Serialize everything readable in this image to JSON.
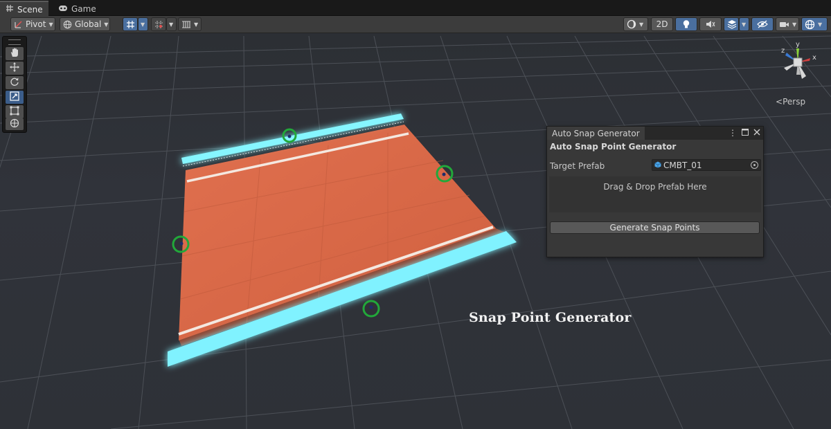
{
  "tabs": [
    {
      "label": "Scene",
      "icon": "grid-icon",
      "active": true
    },
    {
      "label": "Game",
      "icon": "gamepad-icon",
      "active": false
    }
  ],
  "toolbar": {
    "pivot_label": "Pivot",
    "global_label": "Global",
    "mode_2d_label": "2D"
  },
  "tools": [
    {
      "name": "hand-tool",
      "icon": "hand-icon"
    },
    {
      "name": "move-tool",
      "icon": "move-icon"
    },
    {
      "name": "rotate-tool",
      "icon": "rotate-icon"
    },
    {
      "name": "scale-tool",
      "icon": "scale-icon",
      "selected": true
    },
    {
      "name": "rect-tool",
      "icon": "rect-icon"
    },
    {
      "name": "transform-tool",
      "icon": "transform-icon"
    }
  ],
  "gizmo": {
    "axis_y": "y",
    "axis_z": "z",
    "axis_x": "x",
    "projection_label": "Persp"
  },
  "panel": {
    "tab_title": "Auto Snap Generator",
    "heading": "Auto Snap Point Generator",
    "target_label": "Target Prefab",
    "target_value": "CMBT_01",
    "drop_text": "Drag & Drop Prefab Here",
    "generate_label": "Generate Snap Points"
  },
  "caption": "Snap Point Generator",
  "colors": {
    "accent_blue": "#4a6f9f",
    "floor": "#d9694a",
    "rail": "#7ff4ff",
    "snap_marker": "#22a83a"
  }
}
